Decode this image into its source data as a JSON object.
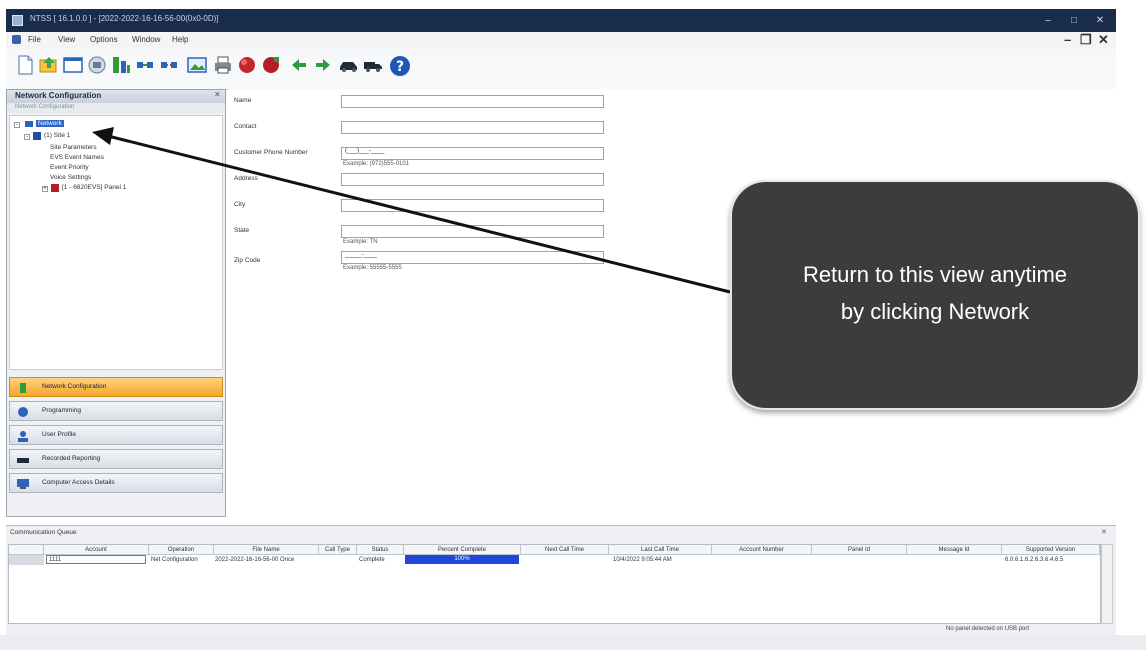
{
  "window": {
    "title": "NTSS [ 16.1.0.0 ] - [2022-2022-16-16-56-00(0x0-0D)]",
    "controls": {
      "minimize": "–",
      "maximize": "□",
      "close": "✕"
    }
  },
  "menu": {
    "items": [
      "File",
      "View",
      "Options",
      "Window",
      "Help"
    ],
    "mdi_controls": {
      "minimize": "–",
      "restore": "❐",
      "close": "✕"
    }
  },
  "toolbar": {
    "icons": [
      "new-icon",
      "open-icon",
      "window-icon",
      "panel-icon",
      "network-tree-icon",
      "connect-icon",
      "disconnect-icon",
      "image-icon",
      "print-icon",
      "red-sphere-icon",
      "red-record-icon",
      "arrow-left-icon",
      "arrow-right-icon",
      "car-icon",
      "truck-icon",
      "help-icon"
    ]
  },
  "left_panel": {
    "title": "Network Configuration",
    "subtitle": "Network Configuration",
    "close_glyph": "✕",
    "tree": {
      "root": "Network",
      "site": "(1) Site 1",
      "children": [
        "Site Parameters",
        "EVS Event Names",
        "Event Priority",
        "Voice Settings"
      ],
      "panel": "[1 - 6820EVS] Panel 1"
    },
    "nav": [
      {
        "label": "Network Configuration",
        "active": true
      },
      {
        "label": "Programming",
        "active": false
      },
      {
        "label": "User Profile",
        "active": false
      },
      {
        "label": "Recorded Reporting",
        "active": false
      },
      {
        "label": "Computer Access Details",
        "active": false
      }
    ]
  },
  "form": {
    "fields": [
      {
        "label": "Name",
        "value": "",
        "example": ""
      },
      {
        "label": "Contact",
        "value": "",
        "example": ""
      },
      {
        "label": "Customer Phone Number",
        "value": "(___)___-____",
        "example": "Example: (972)555-0101"
      },
      {
        "label": "Address",
        "value": "",
        "example": ""
      },
      {
        "label": "City",
        "value": "",
        "example": ""
      },
      {
        "label": "State",
        "value": "",
        "example": "Example: TN"
      },
      {
        "label": "Zip Code",
        "value": "_____-____",
        "example": "Example: 55555-5555"
      }
    ]
  },
  "callout": {
    "line1": "Return to this view anytime",
    "line2": "by clicking Network"
  },
  "queue": {
    "title": "Communication Queue",
    "close_glyph": "✕",
    "columns": [
      "Account",
      "Operation",
      "File Name",
      "Call Type",
      "Status",
      "Percent Complete",
      "Next Call Time",
      "Last Call Time",
      "Account Number",
      "Panel Id",
      "Message Id",
      "Supported Version"
    ],
    "row": {
      "account": "1111",
      "operation": "Net Configuration",
      "file_name": "2022-2022-16-16-56-00 Once",
      "call_type": "",
      "status": "Complete",
      "percent": "100%",
      "percent_value": 1.0,
      "next_call_time": "",
      "last_call_time": "10/4/2022 9:05:44 AM",
      "account_number": "",
      "panel_id": "",
      "message_id": "",
      "supported_version": "6.0.6.1.6.2.6.3.6.4.6.5"
    },
    "status_text": "No panel detected on USB port"
  },
  "colors": {
    "titlebar": "#1a2c4b",
    "nav_active": "#f4a62a",
    "selection": "#2f64c8",
    "progress": "#1f47d9",
    "callout_bg": "#3c3c3c"
  }
}
